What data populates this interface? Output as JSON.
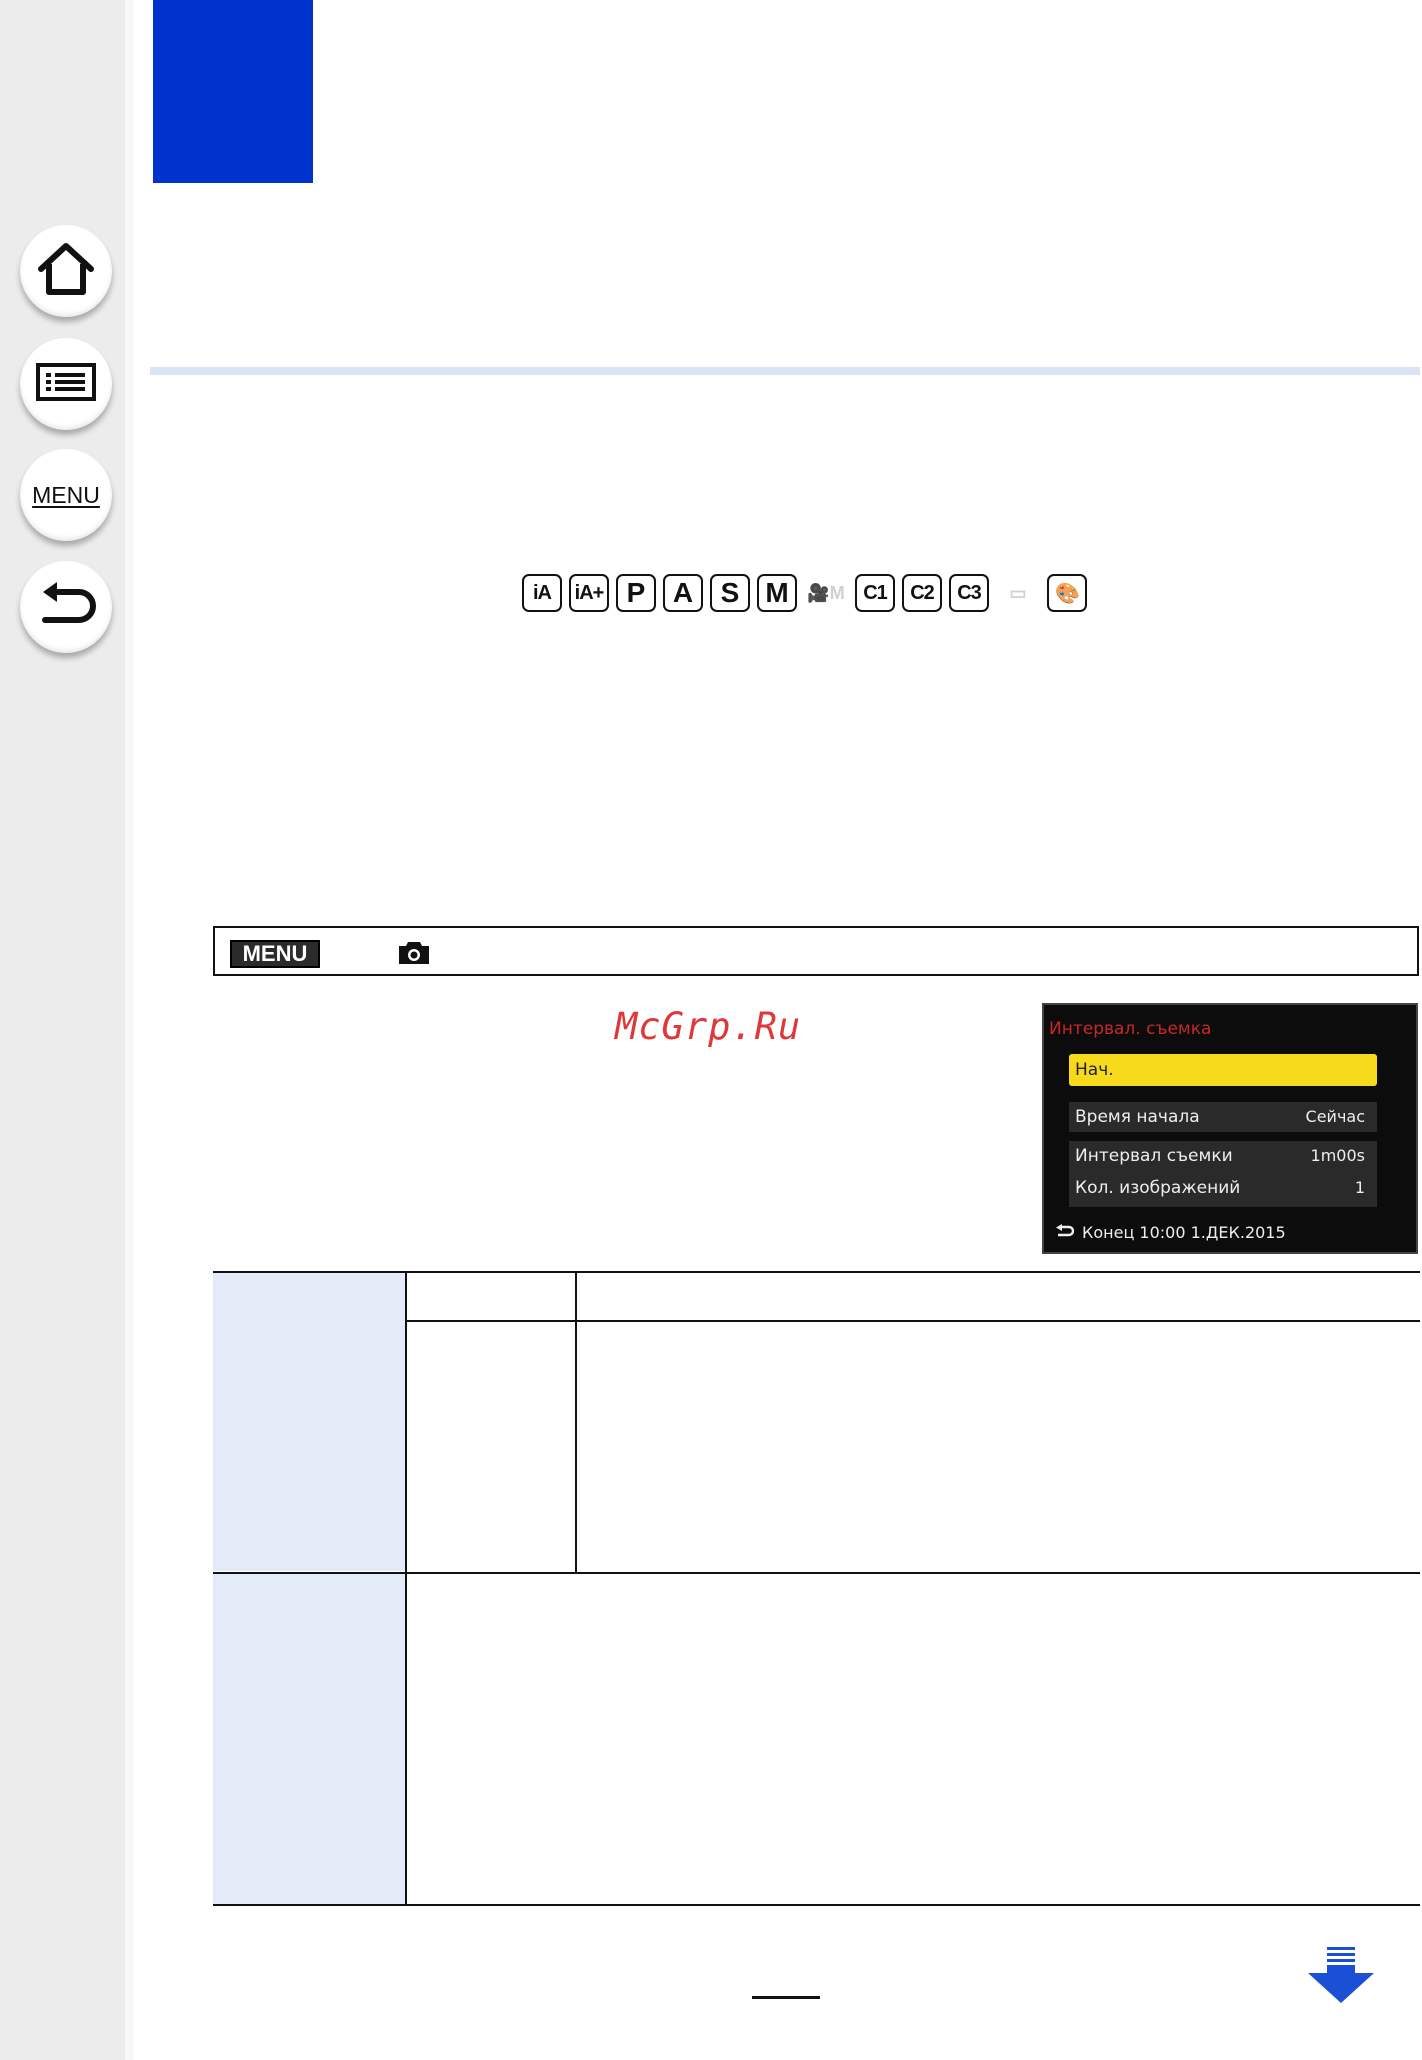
{
  "sidebar": {
    "home_icon": "home-icon",
    "contents_icon": "list-icon",
    "menu_label": "MENU",
    "back_icon": "return-icon"
  },
  "header": {
    "chapter_block_color": "#0033cc"
  },
  "modes": [
    "iA",
    "iA+",
    "P",
    "A",
    "S",
    "M",
    "🎥M",
    "C1",
    "C2",
    "C3",
    "▭",
    "🎨"
  ],
  "menu_path": {
    "badge": "MENU",
    "camera_icon": "camera-icon"
  },
  "watermark": "McGrp.Ru",
  "camera_screen": {
    "title": "Интервал. съемка",
    "start_label": "Нач.",
    "rows": [
      {
        "label": "Время начала",
        "value": "Сейчас"
      },
      {
        "label": "Интервал съемки",
        "value": "1m00s"
      },
      {
        "label": "Кол. изображений",
        "value": "1"
      }
    ],
    "footer": "Конец 10:00  1.ДЕК.2015"
  },
  "colors": {
    "accent": "#0033cc",
    "table_header_bg": "#e3ebf8",
    "lcd_highlight": "#f7da1c",
    "lcd_title": "#c82828",
    "watermark": "#e0383a"
  },
  "next_page_icon": "arrow-down-icon"
}
